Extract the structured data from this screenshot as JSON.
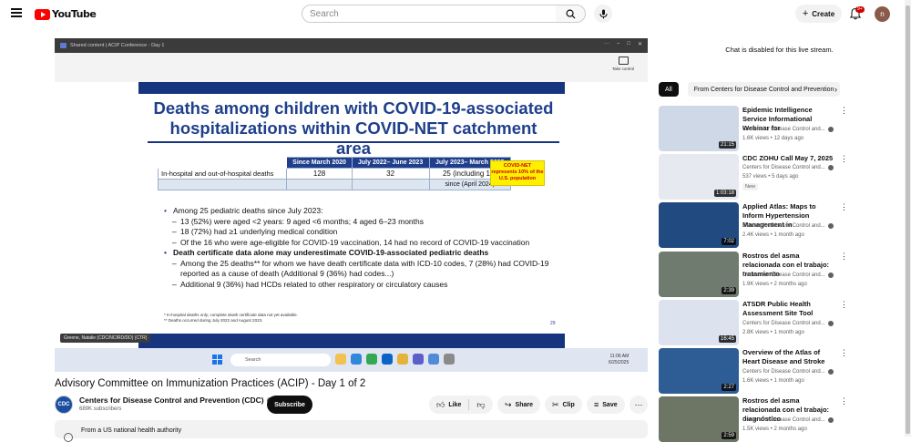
{
  "header": {
    "logo_text": "YouTube",
    "search_placeholder": "Search",
    "create_label": "Create",
    "notification_count": "9+",
    "avatar_letter": "n"
  },
  "player": {
    "window_title": "Shared content | ACIP Conference - Day 1",
    "take_control": "Take control",
    "slide": {
      "title": "Deaths among children with COVID-19-associated hospitalizations within COVID-NET catchment area",
      "table": {
        "headers": [
          "",
          "Since March 2020",
          "July 2022– June 2023",
          "July 2023– March 2025"
        ],
        "row_label": "In-hospital and out-of-hospital deaths",
        "row_values": [
          "128",
          "32",
          "25 (including 10*",
          "since (April 2024)"
        ]
      },
      "callout": "COVID-NET represents 10% of the U.S. population",
      "bullets": [
        {
          "level": 1,
          "text": "Among 25 pediatric deaths since July 2023:"
        },
        {
          "level": 2,
          "text": "13 (52%) were aged <2 years:  9 aged <6 months; 4 aged 6–23 months"
        },
        {
          "level": 2,
          "text": "18 (72%) had ≥1 underlying medical condition"
        },
        {
          "level": 2,
          "text": "Of the 16 who were age-eligible for COVID-19 vaccination, 14 had no record of COVID-19 vaccination"
        },
        {
          "level": 1,
          "text": "Death certificate data alone may underestimate COVID-19-associated pediatric deaths"
        },
        {
          "level": 2,
          "text": "Among the 25 deaths** for whom we have death certificate data with ICD-10 codes, 7 (28%) had COVID-19 reported as a cause of death (Additional 9 (36%) had codes...)"
        },
        {
          "level": 2,
          "text": "Additional 9 (36%) had HCDs related to other respiratory or circulatory causes"
        }
      ],
      "footnotes": [
        "* In-hospital deaths only; complete death certificate data not yet available.",
        "** Deaths occurred during July 2022 and August 2023."
      ],
      "page_number": "29"
    },
    "caption": "Greene, Natalie (CDC/NCIRD/DD) (CTR)",
    "taskbar": {
      "search_placeholder": "Search",
      "time": "11:06 AM",
      "date": "6/25/2025"
    }
  },
  "video": {
    "title": "Advisory Committee on Immunization Practices (ACIP) - Day 1 of 2",
    "channel": "Centers for Disease Control and Prevention (CDC)",
    "channel_logo": "CDC",
    "subscribers": "689K subscribers",
    "subscribe_label": "Subscribe",
    "like_label": "Like",
    "share_label": "Share",
    "clip_label": "Clip",
    "save_label": "Save",
    "description": "From a US national health authority"
  },
  "sidebar": {
    "chat_notice": "Chat is disabled for this live stream.",
    "chips": [
      "All",
      "From Centers for Disease Control and Prevention"
    ],
    "recommendations": [
      {
        "title": "Epidemic Intelligence Service Informational Webinar for",
        "channel": "Centers for Disease Control and...",
        "meta": "1.6K views • 12 days ago",
        "duration": "21:15",
        "color": "#cfd8e6"
      },
      {
        "title": "CDC ZOHU Call May 7, 2025",
        "channel": "Centers for Disease Control and...",
        "meta": "537 views • 5 days ago",
        "duration": "1:03:18",
        "badge": "New",
        "color": "#e6e9ef"
      },
      {
        "title": "Applied Atlas: Maps to Inform Hypertension Management in",
        "channel": "Centers for Disease Control and...",
        "meta": "2.4K views • 1 month ago",
        "duration": "7:02",
        "color": "#214a80"
      },
      {
        "title": "Rostros del asma relacionada con el trabajo: tratamiento",
        "channel": "Centers for Disease Control and...",
        "meta": "1.9K views • 2 months ago",
        "duration": "2:39",
        "color": "#6f7b6e"
      },
      {
        "title": "ATSDR Public Health Assessment Site Tool",
        "channel": "Centers for Disease Control and...",
        "meta": "2.8K views • 1 month ago",
        "duration": "16:45",
        "color": "#dce3ee"
      },
      {
        "title": "Overview of the Atlas of Heart Disease and Stroke",
        "channel": "Centers for Disease Control and...",
        "meta": "1.6K views • 1 month ago",
        "duration": "2:27",
        "color": "#2e5d95"
      },
      {
        "title": "Rostros del asma relacionada con el trabajo: diagnóstico",
        "channel": "Centers for Disease Control and...",
        "meta": "1.5K views • 2 months ago",
        "duration": "2:59",
        "color": "#6d7565"
      }
    ]
  }
}
